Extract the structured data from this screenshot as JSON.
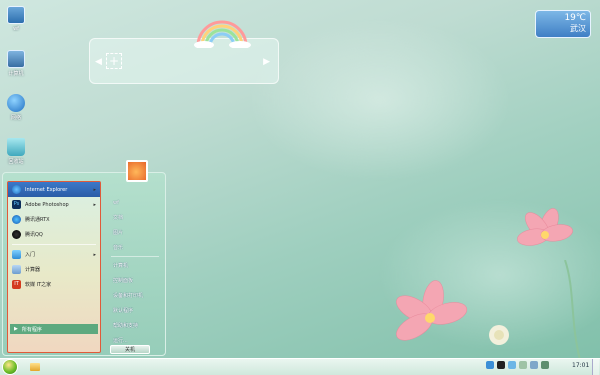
{
  "desktop_icons": [
    {
      "label": "wf",
      "icon": "user-folder-icon"
    },
    {
      "label": "计算机",
      "icon": "computer-icon"
    },
    {
      "label": "网络",
      "icon": "network-icon"
    },
    {
      "label": "回收站",
      "icon": "recycle-bin-icon"
    }
  ],
  "weather": {
    "temp": "19℃",
    "city": "武汉",
    "icon": "weather-cloud-icon"
  },
  "start_menu": {
    "programs": [
      {
        "label": "Internet Explorer",
        "icon": "ie-icon",
        "has_submenu": true,
        "highlighted": true
      },
      {
        "label": "Adobe Photoshop",
        "icon": "photoshop-icon",
        "has_submenu": true,
        "highlighted": false
      },
      {
        "label": "腾讯通RTX",
        "icon": "rtx-icon",
        "has_submenu": false,
        "highlighted": false
      },
      {
        "label": "腾讯QQ",
        "icon": "qq-icon",
        "has_submenu": false,
        "highlighted": false
      },
      {
        "label": "入门",
        "icon": "getting-started-icon",
        "has_submenu": true,
        "highlighted": false
      },
      {
        "label": "计算器",
        "icon": "calculator-icon",
        "has_submenu": false,
        "highlighted": false
      },
      {
        "label": "软媒 IT之家",
        "icon": "ithome-icon",
        "has_submenu": false,
        "highlighted": false
      }
    ],
    "all_programs": "所有程序",
    "right_items": [
      "wf",
      "文档",
      "图片",
      "音乐",
      "计算机",
      "控制面板",
      "设备和打印机",
      "默认程序",
      "帮助和支持",
      "运行..."
    ],
    "shutdown_label": "关机"
  },
  "taskbar": {
    "clock": "17:01"
  }
}
